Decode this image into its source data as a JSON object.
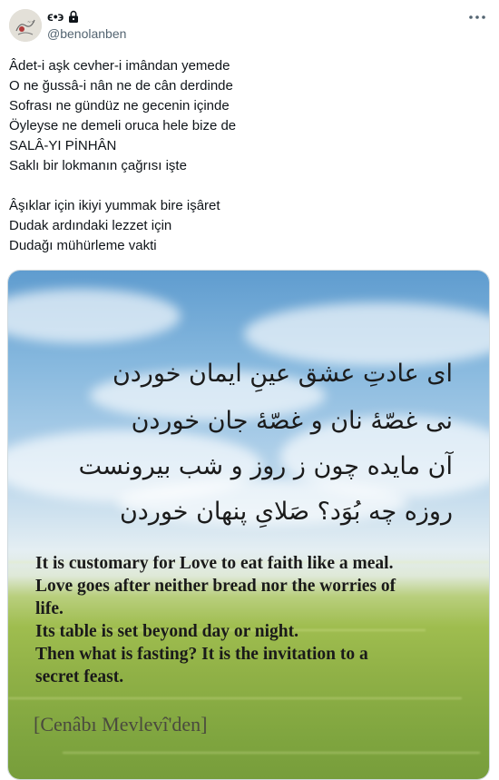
{
  "author": {
    "display_name": "ϵ•϶",
    "handle": "@benolanben",
    "protected": true,
    "avatar_icon": "avatar-drawing-icon"
  },
  "tweet": {
    "lines": [
      "Âdet-i aşk cevher-i imândan yemede",
      "O ne ğussâ-i nân ne de cân derdinde",
      "Sofrası ne gündüz ne gecenin içinde",
      "Öyleyse ne demeli oruca hele bize de",
      "SALÂ-YI PİNHÂN",
      "Saklı bir lokmanın çağrısı işte",
      "",
      "Âşıklar için ikiyi yummak bire işâret",
      "Dudak ardındaki lezzet için",
      "Dudağı mühürleme vakti"
    ]
  },
  "image": {
    "persian_lines": [
      "ای عادتِ عشق عینِ ایمان خوردن",
      "نی غصّهٔ نان و غصّهٔ جان خوردن",
      "آن مایده چون ز روز و شب بیرونست",
      "روزه چه بُوَد؟ صَلایِ پنهان خوردن"
    ],
    "english_lines": [
      "It is customary for Love to eat faith like a meal.",
      "Love goes after neither bread nor the worries of",
      "life.",
      "Its table is set beyond day or night.",
      "Then what is fasting? It is the invitation to a",
      "secret feast."
    ],
    "signature": "[Cenâbı Mevlevî'den]"
  },
  "colors": {
    "text_primary": "#0f1419",
    "text_secondary": "#536471",
    "border": "#cfd9de"
  }
}
